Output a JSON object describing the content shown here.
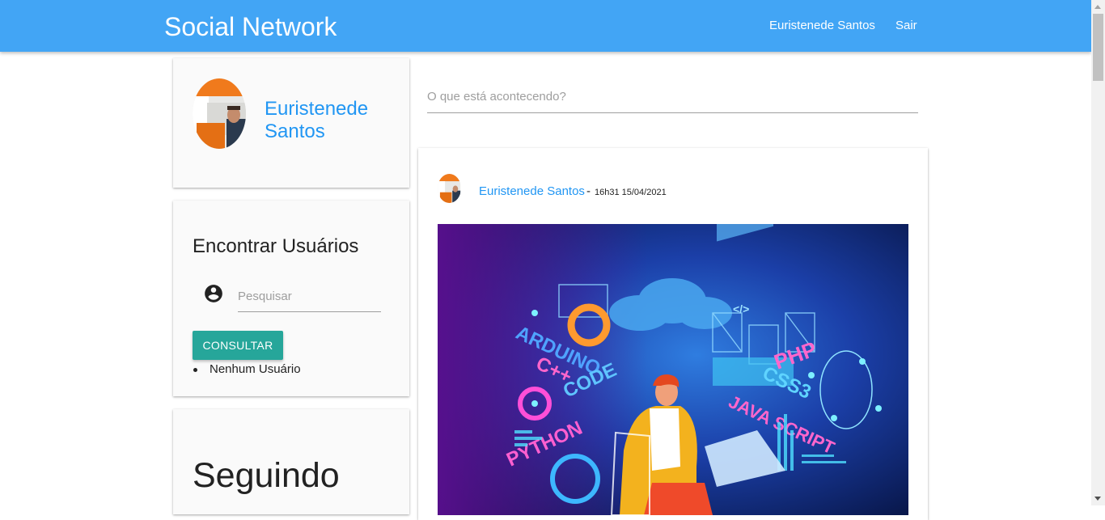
{
  "navbar": {
    "brand": "Social Network",
    "user_link": "Euristenede Santos",
    "logout_link": "Sair"
  },
  "profile": {
    "name": "Euristenede Santos"
  },
  "find_users": {
    "title": "Encontrar Usuários",
    "search_placeholder": "Pesquisar",
    "button_label": "CONSULTAR",
    "results": [
      "Nenhum Usuário"
    ]
  },
  "following": {
    "title": "Seguindo"
  },
  "composer": {
    "placeholder": "O que está acontecendo?"
  },
  "post": {
    "author": "Euristenede Santos",
    "separator": "-",
    "timestamp": "16h31 15/04/2021",
    "image_labels": [
      "ARDUINO",
      "C++",
      "CODE",
      "PYTHON",
      "PHP",
      "CSS3",
      "JAVA SCRIPT",
      "</>"
    ]
  },
  "colors": {
    "navbar": "#42a5f5",
    "link": "#2196f3",
    "button": "#26a69a"
  }
}
